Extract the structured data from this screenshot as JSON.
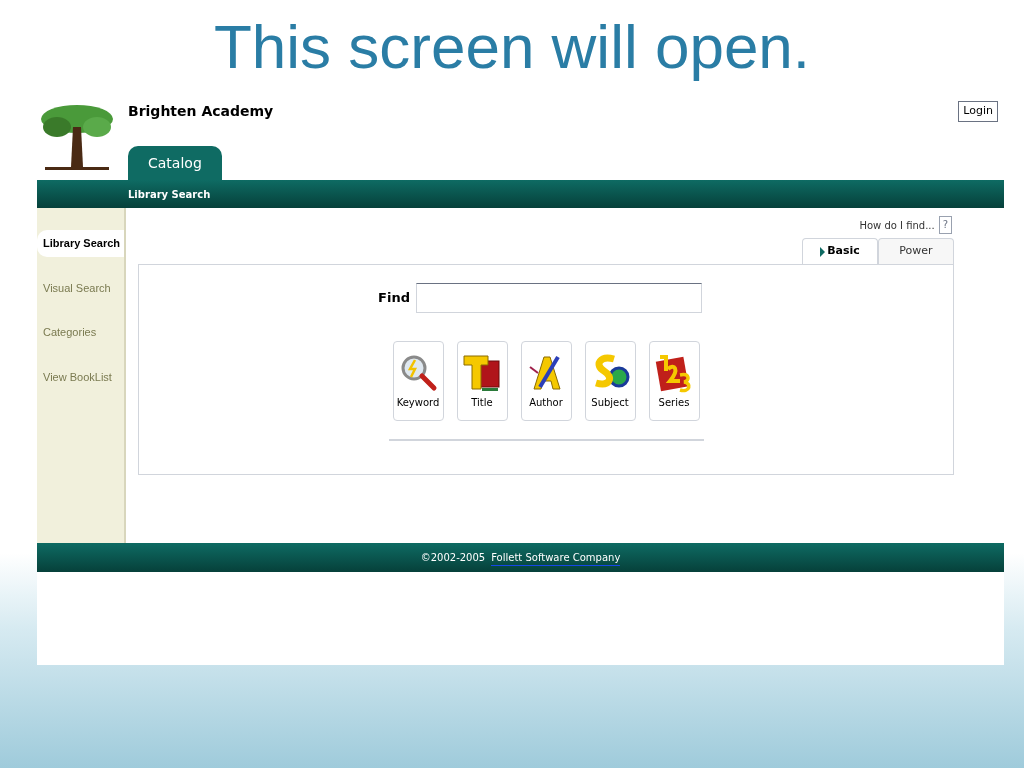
{
  "slide_title": "This screen will open.",
  "header": {
    "school_name": "Brighten Academy",
    "login_button": "Login",
    "tabs": [
      {
        "label": "Catalog",
        "selected": true
      }
    ]
  },
  "subnav": {
    "label": "Library Search"
  },
  "sidebar": {
    "items": [
      {
        "label": "Library Search",
        "selected": true
      },
      {
        "label": "Visual Search",
        "selected": false
      },
      {
        "label": "Categories",
        "selected": false
      },
      {
        "label": "View BookList",
        "selected": false
      }
    ]
  },
  "help": {
    "label": "How do I find...",
    "icon_text": "?"
  },
  "search_tabs": [
    {
      "label": "Basic",
      "selected": true
    },
    {
      "label": "Power",
      "selected": false
    }
  ],
  "find": {
    "label": "Find"
  },
  "search_buttons": [
    {
      "kind": "keyword",
      "label": "Keyword"
    },
    {
      "kind": "title",
      "label": "Title"
    },
    {
      "kind": "author",
      "label": "Author"
    },
    {
      "kind": "subject",
      "label": "Subject"
    },
    {
      "kind": "series",
      "label": "Series"
    }
  ],
  "footer": {
    "copyright": "©2002-2005",
    "company_link": "Follett Software Company"
  }
}
